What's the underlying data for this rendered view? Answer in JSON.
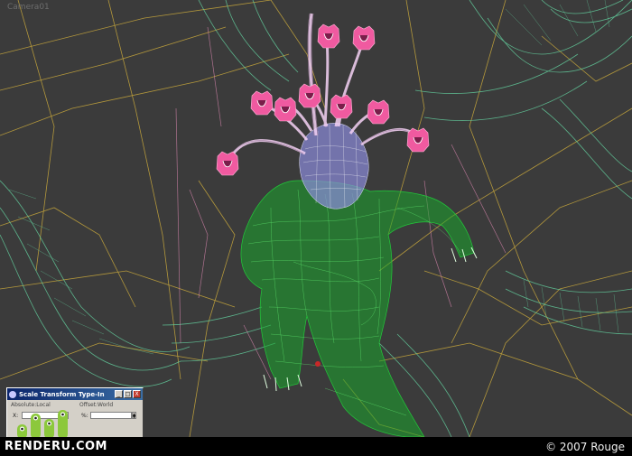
{
  "viewport": {
    "label": "Camera01",
    "colors": {
      "background": "#3b3b3b",
      "body_mesh": "#22c83a",
      "head_mesh": "#c8c8ff",
      "tentacle_mesh": "#f2c8f2",
      "pods": "#f05aa0",
      "environment_cyan": "#64d2a0",
      "environment_yellow": "#c8a83c",
      "environment_pink": "#e08ab4"
    }
  },
  "dialog": {
    "title": "Scale Transform Type-In",
    "absolute_label": "Absolute:Local",
    "offset_label": "Offset:World",
    "axis_x": "X:",
    "axis_pct": "%:",
    "minimize": "_",
    "maximize": "□",
    "close": "X"
  },
  "footer": {
    "brand": "RENDERU.COM",
    "copyright": "© 2007 Rouge"
  },
  "logo": {
    "colors": {
      "bars": "#8cc83c",
      "eyes": "#1a1a1a"
    }
  }
}
